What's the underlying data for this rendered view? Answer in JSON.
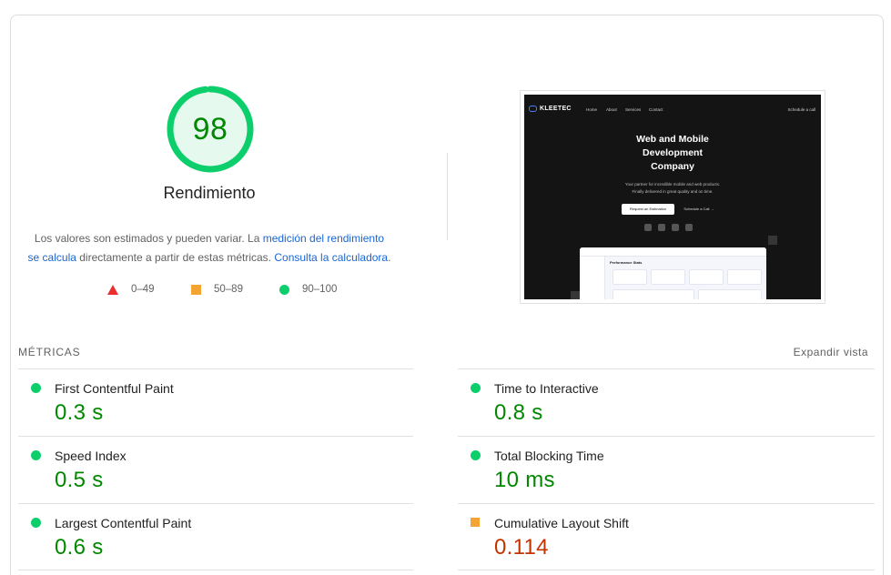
{
  "gauge": {
    "score": "98",
    "score_fraction": 0.98,
    "color": "#0cce6b",
    "title": "Rendimiento",
    "desc_part1": "Los valores son estimados y pueden variar. La ",
    "desc_link1": "medición del rendimiento se calcula",
    "desc_part2": " directamente a partir de estas métricas. ",
    "desc_link2": "Consulta la calculadora",
    "desc_part3": "."
  },
  "legend": [
    {
      "shape": "triangle",
      "color": "#eb2f2f",
      "label": "0–49"
    },
    {
      "shape": "square",
      "color": "#f4a433",
      "label": "50–89"
    },
    {
      "shape": "circle",
      "color": "#0cce6b",
      "label": "90–100"
    }
  ],
  "screenshot": {
    "logo": "KLEETEC",
    "nav": [
      "Home",
      "About",
      "Services",
      "Contact"
    ],
    "call": "Schedule a call",
    "hero_line1": "Web and Mobile",
    "hero_line2": "Development",
    "hero_line3": "Company",
    "sub_line1": "Your partner for incredible mobile and web products.",
    "sub_line2": "Finally delivered in great quality and on time.",
    "btn_primary": "Request an Estimation",
    "btn_secondary": "Schedule a Call →",
    "dash_title": "Performance Stats"
  },
  "metrics": {
    "title": "MÉTRICAS",
    "toggle": "Expandir vista",
    "left": [
      {
        "label": "First Contentful Paint",
        "value": "0.3 s",
        "rating": "pass"
      },
      {
        "label": "Speed Index",
        "value": "0.5 s",
        "rating": "pass"
      },
      {
        "label": "Largest Contentful Paint",
        "value": "0.6 s",
        "rating": "pass"
      }
    ],
    "right": [
      {
        "label": "Time to Interactive",
        "value": "0.8 s",
        "rating": "pass"
      },
      {
        "label": "Total Blocking Time",
        "value": "10 ms",
        "rating": "pass"
      },
      {
        "label": "Cumulative Layout Shift",
        "value": "0.114",
        "rating": "average"
      }
    ]
  }
}
